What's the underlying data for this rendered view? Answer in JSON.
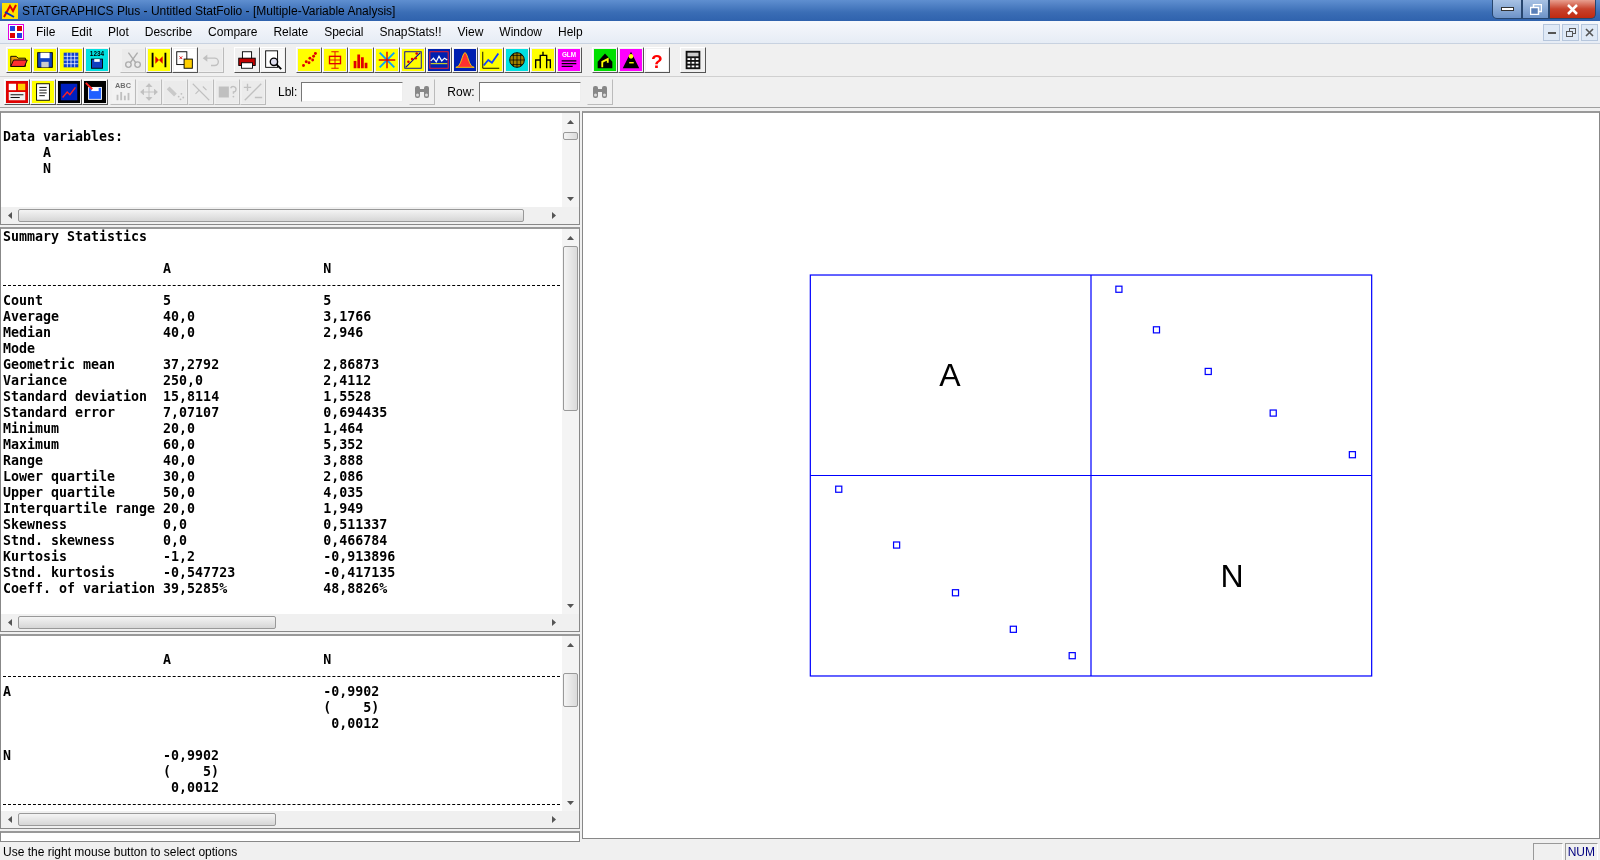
{
  "window": {
    "title": "STATGRAPHICS Plus - Untitled StatFolio - [Multiple-Variable Analysis]"
  },
  "menu": [
    "File",
    "Edit",
    "Plot",
    "Describe",
    "Compare",
    "Relate",
    "Special",
    "SnapStats!!",
    "View",
    "Window",
    "Help"
  ],
  "toolbar": {
    "groups": [
      [
        {
          "kind": "folder",
          "disabled": false
        },
        {
          "kind": "floppy",
          "disabled": false
        },
        {
          "kind": "grid",
          "disabled": false
        },
        {
          "kind": "numbered-floppy",
          "label": "1234",
          "disabled": false
        }
      ],
      [
        {
          "kind": "scissors",
          "disabled": true
        },
        {
          "kind": "swap",
          "disabled": false
        },
        {
          "kind": "clipboard",
          "disabled": false
        },
        {
          "kind": "undo",
          "disabled": true
        }
      ],
      [
        {
          "kind": "printer",
          "disabled": false
        },
        {
          "kind": "preview",
          "disabled": false
        }
      ],
      [
        {
          "kind": "dots",
          "disabled": false
        },
        {
          "kind": "boxplot",
          "disabled": false
        },
        {
          "kind": "bars",
          "disabled": false
        },
        {
          "kind": "cross-arrows",
          "disabled": false
        },
        {
          "kind": "scatter-line",
          "disabled": false
        },
        {
          "kind": "wave",
          "disabled": false
        },
        {
          "kind": "bell",
          "disabled": false
        },
        {
          "kind": "line-chart",
          "disabled": false
        },
        {
          "kind": "globe",
          "disabled": false
        },
        {
          "kind": "tree",
          "disabled": false
        },
        {
          "kind": "glm",
          "label": "GLM",
          "disabled": false
        }
      ],
      [
        {
          "kind": "house",
          "disabled": false
        },
        {
          "kind": "person",
          "disabled": false
        },
        {
          "kind": "help",
          "label": "?",
          "disabled": false
        }
      ],
      [
        {
          "kind": "calculator",
          "disabled": false
        }
      ]
    ]
  },
  "analysis_toolbar": {
    "groups": [
      [
        {
          "kind": "red-panel",
          "disabled": false
        },
        {
          "kind": "document",
          "disabled": false
        },
        {
          "kind": "chart-window",
          "disabled": false
        },
        {
          "kind": "save-window",
          "disabled": false
        }
      ],
      [
        {
          "kind": "abc-chart",
          "label": "ABC",
          "disabled": true
        },
        {
          "kind": "move",
          "disabled": true
        },
        {
          "kind": "spray",
          "disabled": true
        },
        {
          "kind": "diagonal",
          "disabled": true
        },
        {
          "kind": "question-box",
          "disabled": true
        },
        {
          "kind": "plus-minus",
          "disabled": true
        }
      ]
    ],
    "label_field": {
      "label": "Lbl:"
    },
    "label_find": {
      "disabled": true
    },
    "row_field": {
      "label": "Row:"
    },
    "row_find": {
      "disabled": true
    }
  },
  "data_variables_pane": {
    "heading": "Data variables:",
    "variables": [
      "A",
      "N"
    ]
  },
  "summary_pane": {
    "title": "Summary Statistics",
    "columns": [
      "A",
      "N"
    ],
    "rows": [
      {
        "label": "Count",
        "values": [
          "5",
          "5"
        ]
      },
      {
        "label": "Average",
        "values": [
          "40,0",
          "3,1766"
        ]
      },
      {
        "label": "Median",
        "values": [
          "40,0",
          "2,946"
        ]
      },
      {
        "label": "Mode",
        "values": []
      },
      {
        "label": "Geometric mean",
        "values": [
          "37,2792",
          "2,86873"
        ]
      },
      {
        "label": "Variance",
        "values": [
          "250,0",
          "2,4112"
        ]
      },
      {
        "label": "Standard deviation",
        "values": [
          "15,8114",
          "1,5528"
        ]
      },
      {
        "label": "Standard error",
        "values": [
          "7,07107",
          "0,694435"
        ]
      },
      {
        "label": "Minimum",
        "values": [
          "20,0",
          "1,464"
        ]
      },
      {
        "label": "Maximum",
        "values": [
          "60,0",
          "5,352"
        ]
      },
      {
        "label": "Range",
        "values": [
          "40,0",
          "3,888"
        ]
      },
      {
        "label": "Lower quartile",
        "values": [
          "30,0",
          "2,086"
        ]
      },
      {
        "label": "Upper quartile",
        "values": [
          "50,0",
          "4,035"
        ]
      },
      {
        "label": "Interquartile range",
        "values": [
          "20,0",
          "1,949"
        ]
      },
      {
        "label": "Skewness",
        "values": [
          "0,0",
          "0,511337"
        ]
      },
      {
        "label": "Stnd. skewness",
        "values": [
          "0,0",
          "0,466784"
        ]
      },
      {
        "label": "Kurtosis",
        "values": [
          "-1,2",
          "-0,913896"
        ]
      },
      {
        "label": "Stnd. kurtosis",
        "values": [
          "-0,547723",
          "-0,417135"
        ]
      },
      {
        "label": "Coeff. of variation",
        "values": [
          "39,5285%",
          "48,8826%"
        ]
      }
    ]
  },
  "correlation_pane": {
    "columns": [
      "A",
      "N"
    ],
    "rows": [
      {
        "label": "A",
        "cells": [
          [],
          [
            "-0,9902",
            "(    5)",
            "0,0012"
          ]
        ]
      },
      {
        "label": "N",
        "cells": [
          [
            "-0,9902",
            "(    5)",
            "0,0012"
          ],
          []
        ]
      }
    ]
  },
  "plot": {
    "variables": [
      "A",
      "N"
    ]
  },
  "status_bar": {
    "message": "Use the right mouse button to select options",
    "indicators": [
      "NUM"
    ]
  }
}
